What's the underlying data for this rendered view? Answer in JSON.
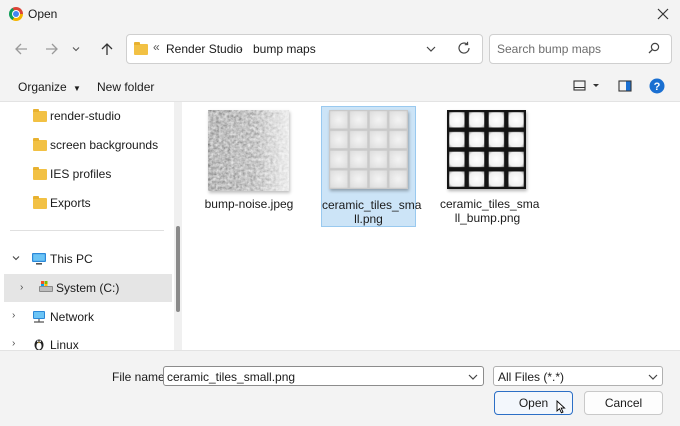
{
  "window": {
    "title": "Open"
  },
  "address": {
    "overflow": "«",
    "crumbs": [
      "Render Studio",
      "bump maps"
    ]
  },
  "search": {
    "placeholder": "Search bump maps"
  },
  "toolbar": {
    "organize_label": "Organize",
    "new_folder_label": "New folder"
  },
  "sidebar": {
    "items": [
      {
        "label": "render-studio",
        "icon": "folder-icon"
      },
      {
        "label": "screen backgrounds",
        "icon": "folder-icon"
      },
      {
        "label": "IES profiles",
        "icon": "folder-icon"
      },
      {
        "label": "Exports",
        "icon": "folder-icon"
      },
      {
        "label": "This PC",
        "icon": "computer-icon"
      },
      {
        "label": "System (C:)",
        "icon": "drive-icon"
      },
      {
        "label": "Network",
        "icon": "network-icon"
      },
      {
        "label": "Linux",
        "icon": "linux-icon"
      }
    ]
  },
  "files": [
    {
      "name_line1": "bump-noise.jpeg",
      "name_line2": ""
    },
    {
      "name_line1": "ceramic_tiles_sma",
      "name_line2": "ll.png"
    },
    {
      "name_line1": "ceramic_tiles_sma",
      "name_line2": "ll_bump.png"
    }
  ],
  "footer": {
    "filename_label": "File name:",
    "filename_value": "ceramic_tiles_small.png",
    "filter_value": "All Files (*.*)",
    "open_label": "Open",
    "cancel_label": "Cancel"
  },
  "colors": {
    "accent": "#0067c0",
    "selection": "#cce4f7",
    "selection_border": "#99c9ef",
    "folder": "#f2c144"
  }
}
